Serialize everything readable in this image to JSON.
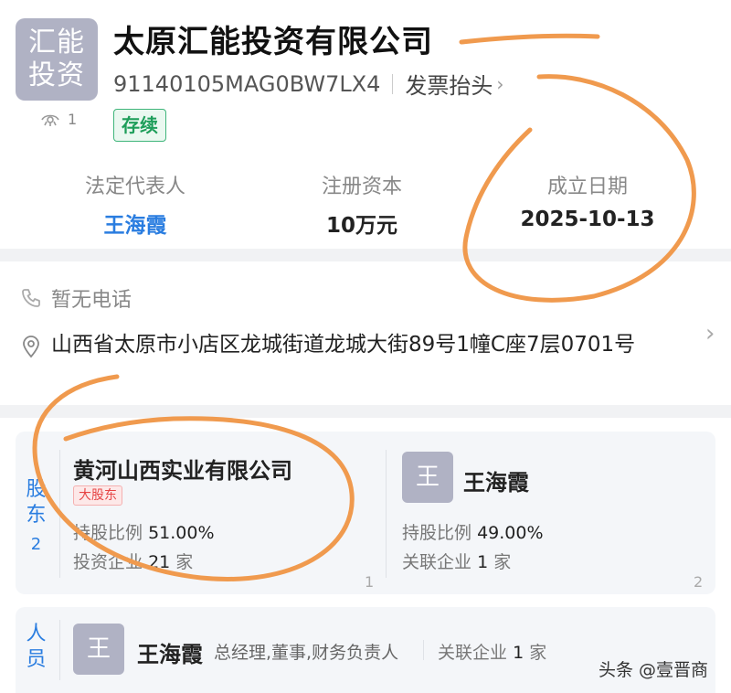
{
  "company": {
    "logo_line1": "汇能",
    "logo_line2": "投资",
    "name": "太原汇能投资有限公司",
    "credit_code": "91140105MAG0BW7LX4",
    "invoice_link": "发票抬头",
    "status": "存续",
    "view_count": "1"
  },
  "stats": [
    {
      "label": "法定代表人",
      "value": "王海霞"
    },
    {
      "label": "注册资本",
      "value": "10万元"
    },
    {
      "label": "成立日期",
      "value": "2025-10-13"
    }
  ],
  "contact": {
    "phone": "暂无电话",
    "address": "山西省太原市小店区龙城街道龙城大街89号1幢C座7层0701号"
  },
  "shareholders": {
    "label_main": "股东",
    "count": "2",
    "items": [
      {
        "name": "黄河山西实业有限公司",
        "tag": "大股东",
        "ratio_label": "持股比例",
        "ratio": "51.00%",
        "related_label": "投资企业",
        "related_count": "21",
        "related_unit": "家",
        "index": "1"
      },
      {
        "avatar": "王",
        "name": "王海霞",
        "ratio_label": "持股比例",
        "ratio": "49.00%",
        "related_label": "关联企业",
        "related_count": "1",
        "related_unit": "家",
        "index": "2"
      }
    ]
  },
  "personnel": {
    "label_main": "人员",
    "items": [
      {
        "avatar": "王",
        "name": "王海霞",
        "roles": "总经理,董事,财务负责人",
        "related_label": "关联企业",
        "related_count": "1",
        "related_unit": "家"
      }
    ]
  },
  "watermark": "头条 @壹晋商",
  "colors": {
    "accent": "#2a7de0",
    "status_green": "#1e9e5a",
    "marker": "#f09a4e",
    "tag_red": "#e64545"
  }
}
